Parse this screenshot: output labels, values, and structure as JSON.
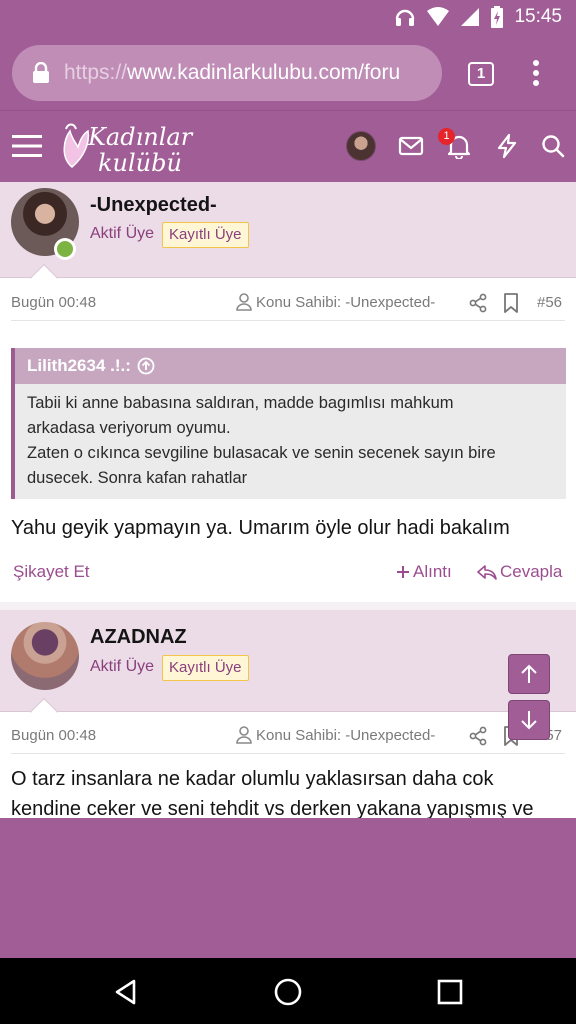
{
  "status_bar": {
    "time": "15:45",
    "icons": [
      "headphones-icon",
      "wifi-icon",
      "signal-icon",
      "battery-charging-icon"
    ]
  },
  "browser": {
    "url_protocol": "https://",
    "url_rest": "www.kadinlarkulubu.com/foru",
    "tab_count": "1"
  },
  "site_nav": {
    "logo_line1": "Kadınlar",
    "logo_line2": "kulübü",
    "notification_count": "1",
    "icons": [
      "menu-icon",
      "user-avatar",
      "mail-icon",
      "bell-icon",
      "lightning-icon",
      "search-icon"
    ]
  },
  "posts": [
    {
      "username": "-Unexpected-",
      "user_title": "Aktif Üye",
      "user_badge": "Kayıtlı Üye",
      "date": "Bugün 00:48",
      "thread_starter": "Konu Sahibi: -Unexpected-",
      "post_number": "#56",
      "quote": {
        "author": "Lilith2634 .!.:",
        "lines": [
          "Tabii ki anne babasına saldıran, madde bagımlısı mahkum",
          "arkadasa veriyorum oyumu.",
          "Zaten o cıkınca sevgiline bulasacak ve senin secenek sayın bire",
          "dusecek. Sonra kafan rahatlar"
        ]
      },
      "message": "Yahu geyik yapmayın ya. Umarım öyle olur hadi bakalım",
      "actions": {
        "report": "Şikayet Et",
        "quote": "Alıntı",
        "reply": "Cevapla"
      }
    },
    {
      "username": "AZADNAZ",
      "user_title": "Aktif Üye",
      "user_badge": "Kayıtlı Üye",
      "date": "Bugün 00:48",
      "thread_starter": "Konu Sahibi: -Unexpected-",
      "post_number": "#57",
      "message_lines": [
        "O tarz insanlara ne kadar olumlu yaklasırsan daha cok",
        "kendine ceker ve seni tehdit vs derken yakana yapışmış ve"
      ]
    }
  ],
  "colors": {
    "brand": "#a15d96",
    "header_bg": "#ebdce7",
    "badge_border": "#f2c44a",
    "link": "#9c4d8f"
  }
}
